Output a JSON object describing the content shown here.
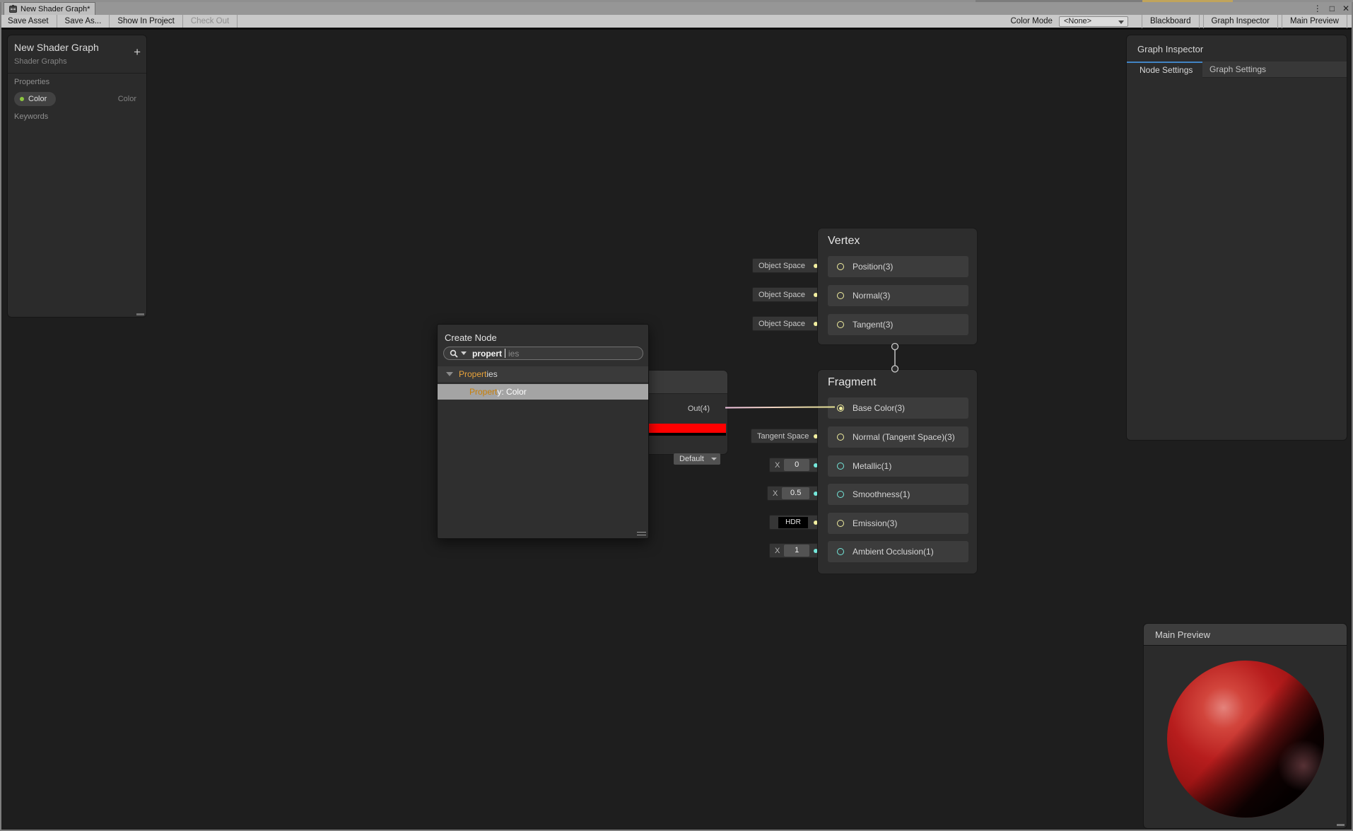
{
  "window": {
    "tab_title": "New Shader Graph*",
    "menu_icon": "⋮",
    "maximize_icon": "□",
    "close_icon": "✕"
  },
  "toolbar": {
    "save_asset": "Save Asset",
    "save_as": "Save As...",
    "show_in_project": "Show In Project",
    "check_out": "Check Out",
    "color_mode_label": "Color Mode",
    "color_mode_value": "<None>",
    "blackboard": "Blackboard",
    "graph_inspector": "Graph Inspector",
    "main_preview": "Main Preview"
  },
  "blackboard": {
    "title": "New Shader Graph",
    "subtitle": "Shader Graphs",
    "add_button": "+",
    "properties_label": "Properties",
    "keywords_label": "Keywords",
    "property": {
      "name": "Color",
      "type": "Color",
      "dot_color": "#8CC63F"
    }
  },
  "create_node": {
    "title": "Create Node",
    "search_typed": "propert",
    "search_hint": "ies",
    "category": {
      "match": "Propert",
      "rest": "ies"
    },
    "result": {
      "match": "Propert",
      "rest": "y: Color"
    }
  },
  "color_node": {
    "out_label": "Out(4)",
    "out_port_color": "#F2BCE3",
    "swatch_color": "#FF0000",
    "dropdown_value": "Default"
  },
  "vertex_node": {
    "title": "Vertex",
    "rows": [
      {
        "chip": "Object Space",
        "label": "Position(3)",
        "port_color": "#F2EFA0"
      },
      {
        "chip": "Object Space",
        "label": "Normal(3)",
        "port_color": "#F2EFA0"
      },
      {
        "chip": "Object Space",
        "label": "Tangent(3)",
        "port_color": "#F2EFA0"
      }
    ]
  },
  "fragment_node": {
    "title": "Fragment",
    "rows": [
      {
        "label": "Base Color(3)",
        "port_color": "#F2EFA0",
        "connected": true
      },
      {
        "chip": "Tangent Space",
        "label": "Normal (Tangent Space)(3)",
        "port_color": "#F2EFA0"
      },
      {
        "chip_x": "X",
        "value": "0",
        "label": "Metallic(1)",
        "port_color": "#74E8DB"
      },
      {
        "chip_x": "X",
        "value": "0.5",
        "label": "Smoothness(1)",
        "port_color": "#74E8DB"
      },
      {
        "chip_hdr": "HDR",
        "label": "Emission(3)",
        "port_color": "#F2EFA0"
      },
      {
        "chip_x": "X",
        "value": "1",
        "label": "Ambient Occlusion(1)",
        "port_color": "#74E8DB"
      }
    ]
  },
  "graph_inspector": {
    "title": "Graph Inspector",
    "tabs": [
      {
        "label": "Node Settings",
        "active": true
      },
      {
        "label": "Graph Settings",
        "active": false
      }
    ]
  },
  "main_preview": {
    "title": "Main Preview",
    "sphere_color": "#B71D1D"
  },
  "colors": {
    "wire_start": "#F0C2DF",
    "wire_end": "#E6E294",
    "tab_accent_blue": "#4284C4"
  }
}
